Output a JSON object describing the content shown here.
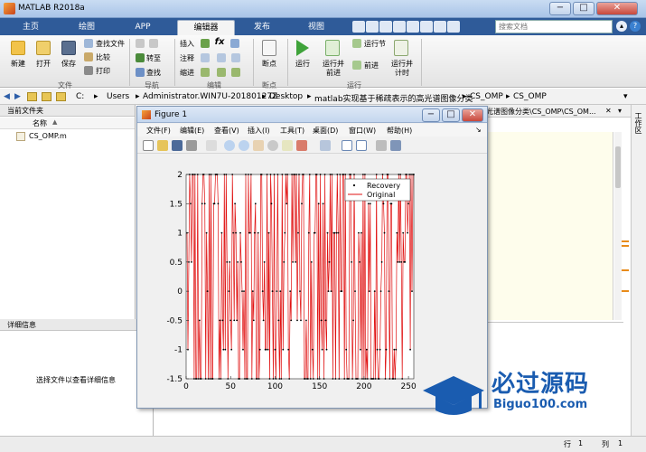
{
  "app": {
    "title": "MATLAB R2018a"
  },
  "tabs": [
    {
      "label": "主页"
    },
    {
      "label": "绘图"
    },
    {
      "label": "APP"
    },
    {
      "label": "编辑器"
    },
    {
      "label": "发布"
    },
    {
      "label": "视图"
    }
  ],
  "search": {
    "placeholder": "搜索文档"
  },
  "ribbon": {
    "new": "新建",
    "open": "打开",
    "save": "保存",
    "find_files": "查找文件",
    "compare": "比较",
    "print": "打印",
    "insert": "插入",
    "goto": "转至",
    "find": "查找",
    "comment": "注释",
    "indent": "缩进",
    "breakpoints": "断点",
    "run": "运行",
    "run_advance_1": "运行并",
    "run_advance_2": "前进",
    "run_section": "运行节",
    "advance": "前进",
    "run_time_1": "运行并",
    "run_time_2": "计时",
    "fx": "fx",
    "groups": {
      "file": "文件",
      "navigate": "导航",
      "edit": "编辑",
      "breakpoints": "断点",
      "run": "运行"
    }
  },
  "breadcrumb": [
    "C:",
    "Users",
    "Administrator.WIN7U-20180127Z",
    "Desktop",
    "matlab实现基于稀疏表示的高光谱图像分类",
    "CS_OMP",
    "CS_OMP"
  ],
  "editor_path": "光谱图像分类\\CS_OMP\\CS_OM...",
  "current_folder": {
    "header": "当前文件夹",
    "col_name": "名称",
    "files": [
      "CS_OMP.m"
    ]
  },
  "details": {
    "header": "详细信息",
    "message": "选择文件以查看详细信息"
  },
  "right_panel": {
    "label": "工作区"
  },
  "figure": {
    "title": "Figure 1",
    "menu": [
      "文件(F)",
      "编辑(E)",
      "查看(V)",
      "插入(I)",
      "工具(T)",
      "桌面(D)",
      "窗口(W)",
      "帮助(H)"
    ]
  },
  "status": {
    "row_label": "行",
    "row": "1",
    "col_label": "列",
    "col": "1"
  },
  "watermark": {
    "text": "必过源码",
    "url": "Biguo100.com"
  },
  "chart_data": {
    "type": "line",
    "xlim": [
      0,
      256
    ],
    "ylim": [
      -1.5,
      2
    ],
    "xticks": [
      0,
      50,
      100,
      150,
      200,
      250
    ],
    "yticks": [
      -1.5,
      -1,
      -0.5,
      0,
      0.5,
      1,
      1.5,
      2
    ],
    "legend_position": "top-right",
    "series": [
      {
        "name": "Recovery",
        "color": "#000000",
        "marker": "k."
      },
      {
        "name": "Original",
        "color": "#e01010",
        "marker": "r-"
      }
    ]
  }
}
